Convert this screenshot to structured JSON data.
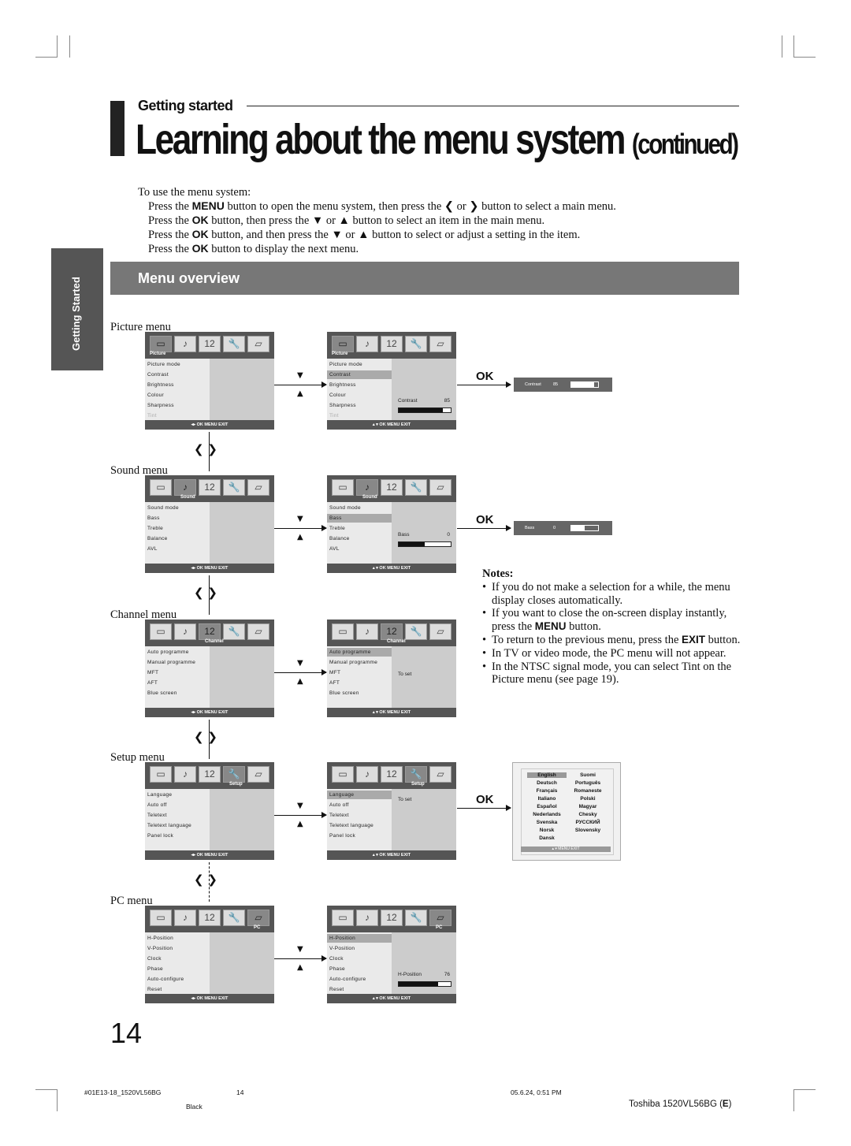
{
  "header": {
    "section": "Getting started",
    "title": "Learning about the menu system",
    "title_suffix": "(continued)"
  },
  "sidetab": "Getting Started",
  "intro": {
    "lead": "To use the menu system:",
    "steps": [
      {
        "a": "Press the ",
        "b": "MENU",
        "c": " button to open the menu system, then press the ❮ or ❯ button to select a main menu."
      },
      {
        "a": "Press the ",
        "b": "OK",
        "c": " button, then press the ▼ or ▲ button to select an item in the main menu."
      },
      {
        "a": "Press the ",
        "b": "OK",
        "c": " button, and then press the ▼ or ▲ button to select or adjust a setting in the item."
      },
      {
        "a": "Press the ",
        "b": "OK",
        "c": " button to display the next menu."
      }
    ]
  },
  "overview_title": "Menu overview",
  "icons": [
    "tv",
    "note",
    "12",
    "wrench",
    "pc"
  ],
  "footer_keys_left": "◂▸ OK MENU EXIT",
  "footer_keys_right": "▴ ▾ OK MENU EXIT",
  "ok_label": "OK",
  "nav_arrows": "❮  ❯",
  "menus": [
    {
      "label": "Picture menu",
      "tab": "Picture",
      "tab_index": 0,
      "items": [
        "Picture mode",
        "Contrast",
        "Brightness",
        "Colour",
        "Sharpness",
        "Tint"
      ],
      "dim": [
        5
      ],
      "selected": 1,
      "setting": "Contrast",
      "setting_value": "85",
      "level": 0.85,
      "mini": {
        "name": "Contrast",
        "value": "85",
        "level": 0.85
      }
    },
    {
      "label": "Sound menu",
      "tab": "Sound",
      "tab_index": 1,
      "items": [
        "Sound mode",
        "Bass",
        "Treble",
        "Balance",
        "AVL"
      ],
      "dim": [],
      "selected": 1,
      "setting": "Bass",
      "setting_value": "0",
      "level": 0.5,
      "mini": {
        "name": "Bass",
        "value": "0",
        "level": 0.5
      }
    },
    {
      "label": "Channel menu",
      "tab": "Channel",
      "tab_index": 2,
      "items": [
        "Auto programme",
        "Manual programme",
        "MFT",
        "AFT",
        "Blue screen"
      ],
      "dim": [],
      "selected": 0,
      "note": "To set"
    },
    {
      "label": "Setup menu",
      "tab": "Setup",
      "tab_index": 3,
      "items": [
        "Language",
        "Auto off",
        "Teletext",
        "Teletext language",
        "Panel lock"
      ],
      "dim": [],
      "selected": 0,
      "note": "To set"
    },
    {
      "label": "PC menu",
      "tab": "PC",
      "tab_index": 4,
      "items": [
        "H-Position",
        "V-Position",
        "Clock",
        "Phase",
        "Auto-configure",
        "Reset"
      ],
      "dim": [],
      "selected": 0,
      "setting": "H-Position",
      "setting_value": "76",
      "level": 0.76
    }
  ],
  "languages": {
    "items": [
      "English",
      "Suomi",
      "Deutsch",
      "Português",
      "Français",
      "Romaneste",
      "Italiano",
      "Polski",
      "Español",
      "Magyar",
      "Nederlands",
      "Chesky",
      "Svenska",
      "РУССКИЙ",
      "Norsk",
      "Slovensky",
      "Dansk"
    ],
    "selected": "English",
    "footer": "▴ ▾  MENU EXIT"
  },
  "notes": {
    "title": "Notes:",
    "items": [
      {
        "a": "If you do not make a selection for a while, the menu display closes automatically."
      },
      {
        "a": "If you want to close the on-screen display instantly, press the ",
        "b": "MENU",
        "c": " button."
      },
      {
        "a": "To return to the previous menu, press the ",
        "b": "EXIT",
        "c": " button."
      },
      {
        "a": "In TV or video mode, the PC menu will not appear."
      },
      {
        "a": "In the NTSC signal mode, you can select Tint on the Picture menu (see page 19)."
      }
    ]
  },
  "page_number": "14",
  "print_footer": {
    "file": "#01E13-18_1520VL56BG",
    "page": "14",
    "date": "05.6.24, 0:51 PM",
    "color": "Black",
    "model_prefix": "Toshiba 1520VL56BG (",
    "model_region": "E",
    "model_suffix": ")"
  }
}
